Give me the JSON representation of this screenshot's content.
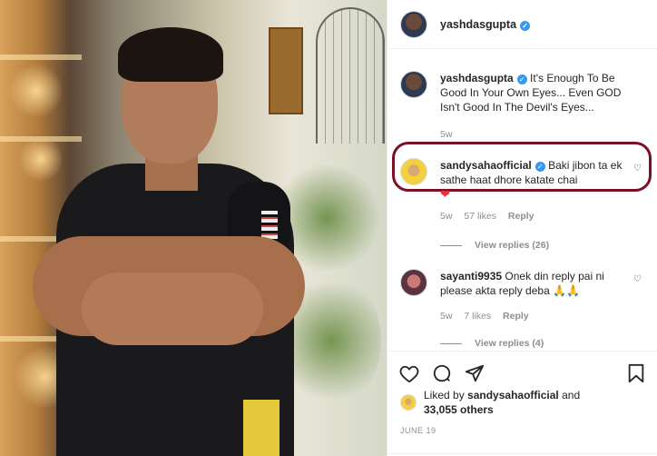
{
  "post": {
    "author": "yashdasgupta",
    "verified": true
  },
  "caption": {
    "username": "yashdasgupta",
    "text": "It's Enough To Be Good In Your Own Eyes... Even GOD Isn't Good In The Devil's Eyes...",
    "age": "5w"
  },
  "comments": [
    {
      "username": "sandysahaofficial",
      "verified": true,
      "text": "Baki jibon ta ek sathe haat dhore katate chai",
      "emoji": "❤",
      "age": "5w",
      "likes": "57 likes",
      "reply_label": "Reply",
      "view_replies": "View replies (26)"
    },
    {
      "username": "sayanti9935",
      "text": "Onek din reply pai ni please akta reply deba 🙏🙏",
      "age": "5w",
      "likes": "7 likes",
      "reply_label": "Reply",
      "view_replies": "View replies (4)"
    }
  ],
  "actions": {
    "like_icon": "heart-icon",
    "comment_icon": "comment-icon",
    "share_icon": "share-icon",
    "save_icon": "bookmark-icon"
  },
  "likes_summary": {
    "prefix": "Liked by",
    "user": "sandysahaofficial",
    "and": "and",
    "others": "33,055 others"
  },
  "date": "JUNE 19",
  "colors": {
    "verified_blue": "#3897f0",
    "highlight_border": "#7a1028",
    "heart_red": "#ed2e3a"
  }
}
